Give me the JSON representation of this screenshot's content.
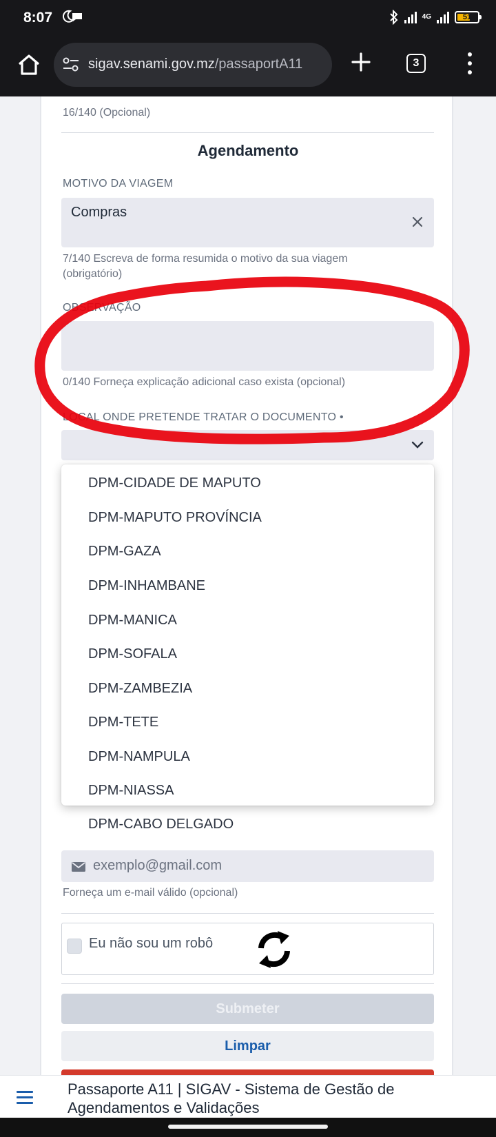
{
  "status_bar": {
    "time": "8:07",
    "network": "4G",
    "battery": "51"
  },
  "browser": {
    "url_domain": "sigav.senami.gov.mz",
    "url_path": "/passaportA11",
    "tab_count": "3"
  },
  "form": {
    "prev_field_counter": "16/140 (Opcional)",
    "section_title": "Agendamento",
    "motivo": {
      "label": "MOTIVO DA VIAGEM",
      "value": "Compras",
      "hint_line1": "7/140 Escreva de forma resumida o motivo da sua viagem",
      "hint_line2": "(obrigatório)"
    },
    "observacao": {
      "label": "OBSERVAÇÃO",
      "value": "",
      "hint": "0/140 Forneça explicação adicional caso exista (opcional)"
    },
    "local": {
      "label": "LOCAL ONDE PRETENDE TRATAR O DOCUMENTO •",
      "selected": "",
      "options": [
        "DPM-CIDADE DE MAPUTO",
        "DPM-MAPUTO PROVÍNCIA",
        "DPM-GAZA",
        "DPM-INHAMBANE",
        "DPM-MANICA",
        "DPM-SOFALA",
        "DPM-ZAMBEZIA",
        "DPM-TETE",
        "DPM-NAMPULA",
        "DPM-NIASSA",
        "DPM-CABO DELGADO"
      ]
    },
    "email": {
      "placeholder": "exemplo@gmail.com",
      "hint": "Forneça um e-mail válido (opcional)"
    },
    "captcha_label": "Eu não sou um robô",
    "submit_label": "Submeter",
    "clear_label": "Limpar"
  },
  "bottom_bar": {
    "title_line1": "Passaporte A11 | SIGAV - Sistema de Gestão de",
    "title_line2": "Agendamentos e Validações"
  },
  "colors": {
    "annotation": "#e8000b",
    "link_blue": "#1a5dab",
    "danger": "#d33a2c"
  }
}
